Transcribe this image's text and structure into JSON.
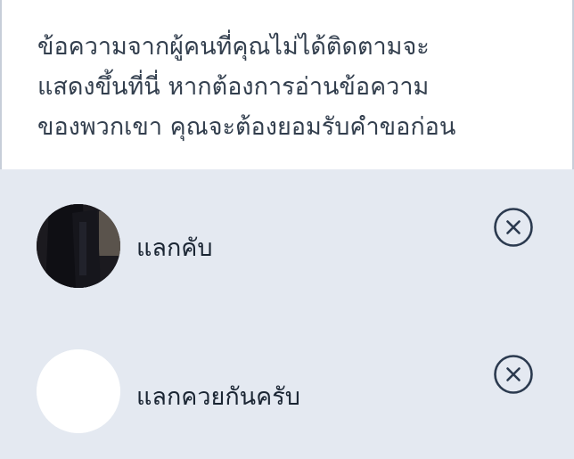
{
  "notice": {
    "text": "ข้อความจากผู้คนที่คุณไม่ได้ติดตามจะ\nแสดงขึ้นที่นี่ หากต้องการอ่านข้อความ\nของพวกเขา คุณจะต้องยอมรับคำขอก่อน"
  },
  "requests": [
    {
      "name": "แลกคับ",
      "avatar": "profile-photo",
      "action_icon": "close-circle-icon"
    },
    {
      "name": "แลกควยกันครับ",
      "avatar": "blank-avatar",
      "action_icon": "close-circle-icon"
    }
  ],
  "colors": {
    "list_background": "#e4e9f1",
    "text_primary": "#1a2533",
    "text_secondary": "#333f4e",
    "icon": "#2b3a4f"
  }
}
